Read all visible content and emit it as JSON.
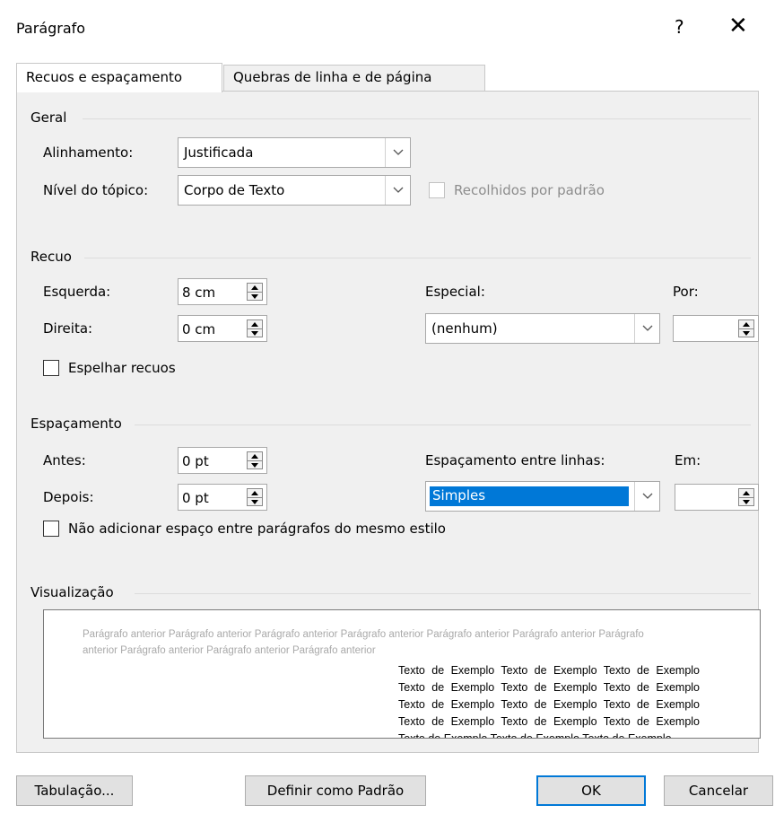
{
  "window": {
    "title": "Parágrafo",
    "help_label": "?",
    "close_label": "✕"
  },
  "tabs": [
    {
      "label": "Recuos e espaçamento"
    },
    {
      "label": "Quebras de linha e de página"
    }
  ],
  "general": {
    "title": "Geral",
    "alignment_label": "Alinhamento:",
    "alignment_value": "Justificada",
    "outline_label": "Nível do tópico:",
    "outline_value": "Corpo de Texto",
    "collapsed_label": "Recolhidos por padrão"
  },
  "indent": {
    "title": "Recuo",
    "left_label": "Esquerda:",
    "left_value": "8 cm",
    "right_label": "Direita:",
    "right_value": "0 cm",
    "special_label": "Especial:",
    "special_value": "(nenhum)",
    "by_label": "Por:",
    "by_value": "",
    "mirror_label": "Espelhar recuos"
  },
  "spacing": {
    "title": "Espaçamento",
    "before_label": "Antes:",
    "before_value": "0 pt",
    "after_label": "Depois:",
    "after_value": "0 pt",
    "line_label": "Espaçamento entre linhas:",
    "line_value": "Simples",
    "at_label": "Em:",
    "at_value": "",
    "no_space_label": "Não adicionar espaço entre parágrafos do mesmo estilo"
  },
  "preview": {
    "title": "Visualização",
    "previous_text": "Parágrafo anterior Parágrafo anterior Parágrafo anterior Parágrafo anterior Parágrafo anterior Parágrafo anterior Parágrafo anterior Parágrafo anterior Parágrafo anterior Parágrafo anterior",
    "sample_text": "Texto de Exemplo Texto de Exemplo Texto de Exemplo Texto de Exemplo Texto de Exemplo Texto de Exemplo Texto de Exemplo Texto de Exemplo Texto de Exemplo Texto de Exemplo Texto de Exemplo Texto de Exemplo Texto de Exemplo Texto de Exemplo Texto de Exemplo"
  },
  "buttons": {
    "tabs": "Tabulação...",
    "set_default": "Definir como Padrão",
    "ok": "OK",
    "cancel": "Cancelar"
  }
}
